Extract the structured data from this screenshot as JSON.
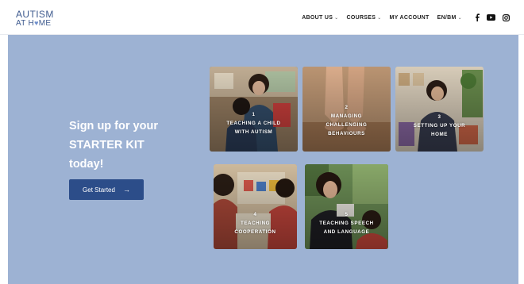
{
  "header": {
    "logo_line1": "AUTISM",
    "logo_line2_a": "AT H",
    "logo_line2_b": "ME",
    "nav": [
      {
        "label": "ABOUT US",
        "dropdown": true
      },
      {
        "label": "COURSES",
        "dropdown": true
      },
      {
        "label": "MY ACCOUNT",
        "dropdown": false
      },
      {
        "label": "EN/BM",
        "dropdown": true
      }
    ],
    "social_icons": [
      "facebook-icon",
      "youtube-icon",
      "instagram-icon"
    ]
  },
  "hero": {
    "title_lines": [
      "Sign up for your",
      "STARTER KIT",
      "today!"
    ],
    "button_label": "Get Started",
    "button_arrow": "→"
  },
  "cards": [
    {
      "number": "1",
      "lines": [
        "TEACHING A CHILD",
        "WITH AUTISM"
      ]
    },
    {
      "number": "2",
      "lines": [
        "MANAGING",
        "CHALLENGING",
        "BEHAVIOURS"
      ]
    },
    {
      "number": "3",
      "lines": [
        "SETTING UP YOUR",
        "HOME"
      ]
    },
    {
      "number": "4",
      "lines": [
        "TEACHING",
        "COOPERATION"
      ]
    },
    {
      "number": "5",
      "lines": [
        "TEACHING SPEECH",
        "AND LANGUAGE"
      ]
    }
  ],
  "colors": {
    "brand": "#3f5b8f",
    "hero_bg": "#9db2d3",
    "button_bg": "#2c4d89"
  }
}
